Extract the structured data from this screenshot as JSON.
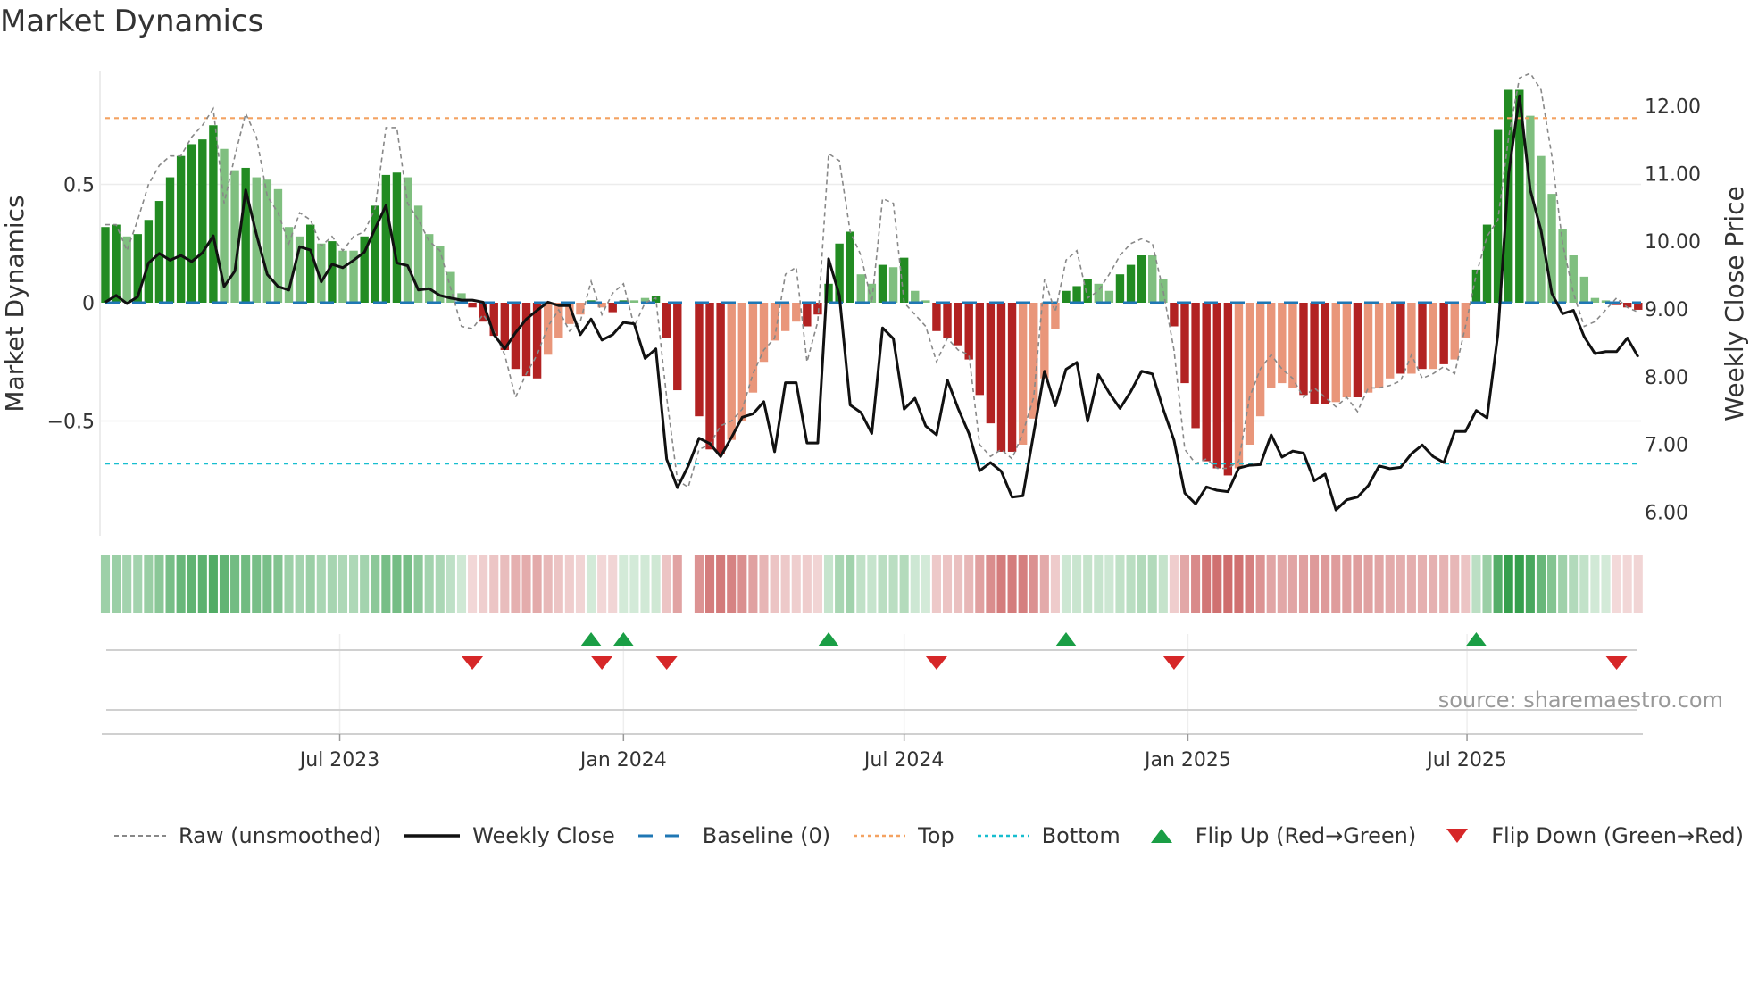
{
  "title": "Market Dynamics",
  "source": "source: sharemaestro.com",
  "legend": {
    "raw": "Raw (unsmoothed)",
    "close": "Weekly Close",
    "baseline": "Baseline (0)",
    "top": "Top",
    "bottom": "Bottom",
    "flip_up": "Flip Up (Red→Green)",
    "flip_down": "Flip Down (Green→Red)"
  },
  "colors": {
    "green_strong": "#228b22",
    "green_weak": "#7fbf7f",
    "red_strong": "#b22222",
    "red_weak": "#e9967a",
    "close": "#111111",
    "raw": "#888888",
    "baseline": "#1f77b4",
    "top": "#f4a261",
    "bottom": "#17becf",
    "flip_up": "#1a9e45",
    "flip_down": "#d62728"
  },
  "chart_data": {
    "type": "bar",
    "title": "Market Dynamics",
    "ylabel": "Market Dynamics",
    "y2label": "Weekly Close Price",
    "ylim": [
      -0.98,
      0.98
    ],
    "y2lim": [
      5.8,
      12.7
    ],
    "yticks": [
      {
        "v": 0.5,
        "label": "0.5"
      },
      {
        "v": 0,
        "label": "0"
      },
      {
        "v": -0.5,
        "label": "−0.5"
      }
    ],
    "y2ticks": [
      {
        "v": 12,
        "label": "12.00"
      },
      {
        "v": 11,
        "label": "11.00"
      },
      {
        "v": 10,
        "label": "10.00"
      },
      {
        "v": 9,
        "label": "9.00"
      },
      {
        "v": 8,
        "label": "8.00"
      },
      {
        "v": 7,
        "label": "7.00"
      },
      {
        "v": 6,
        "label": "6.00"
      }
    ],
    "xticks": [
      {
        "date": "2023-07-01",
        "label": "Jul 2023"
      },
      {
        "date": "2024-01-01",
        "label": "Jan 2024"
      },
      {
        "date": "2024-07-01",
        "label": "Jul 2024"
      },
      {
        "date": "2025-01-01",
        "label": "Jan 2025"
      },
      {
        "date": "2025-07-01",
        "label": "Jul 2025"
      }
    ],
    "start_date": "2023-01-30",
    "frequency": "weekly",
    "top_level": 0.78,
    "bottom_level": -0.68,
    "baseline": 0,
    "momentum": [
      0.32,
      0.33,
      0.28,
      0.29,
      0.35,
      0.43,
      0.53,
      0.62,
      0.67,
      0.69,
      0.75,
      0.65,
      0.56,
      0.57,
      0.53,
      0.52,
      0.48,
      0.32,
      0.28,
      0.33,
      0.25,
      0.26,
      0.22,
      0.22,
      0.28,
      0.41,
      0.54,
      0.55,
      0.53,
      0.41,
      0.29,
      0.24,
      0.13,
      0.04,
      -0.02,
      -0.08,
      -0.14,
      -0.2,
      -0.28,
      -0.31,
      -0.32,
      -0.22,
      -0.15,
      -0.09,
      -0.05,
      0.01,
      -0.02,
      -0.04,
      0.01,
      0.01,
      0.02,
      0.03,
      -0.15,
      -0.37,
      null,
      -0.48,
      -0.62,
      -0.64,
      -0.58,
      -0.5,
      -0.38,
      -0.25,
      -0.16,
      -0.12,
      -0.08,
      -0.1,
      -0.05,
      0.08,
      0.25,
      0.3,
      0.12,
      0.08,
      0.16,
      0.15,
      0.19,
      0.05,
      0.01,
      -0.12,
      -0.15,
      -0.18,
      -0.24,
      -0.39,
      -0.51,
      -0.63,
      -0.63,
      -0.6,
      -0.49,
      -0.32,
      -0.11,
      0.05,
      0.07,
      0.1,
      0.08,
      0.05,
      0.12,
      0.16,
      0.2,
      0.2,
      0.1,
      -0.1,
      -0.34,
      -0.53,
      -0.67,
      -0.7,
      -0.73,
      -0.7,
      -0.6,
      -0.48,
      -0.36,
      -0.34,
      -0.36,
      -0.39,
      -0.43,
      -0.43,
      -0.42,
      -0.4,
      -0.4,
      -0.38,
      -0.36,
      -0.32,
      -0.3,
      -0.3,
      -0.28,
      -0.28,
      -0.26,
      -0.24,
      -0.15,
      0.14,
      0.33,
      0.73,
      0.9,
      0.9,
      0.79,
      0.62,
      0.46,
      0.31,
      0.2,
      0.11,
      0.02,
      0.01,
      -0.01,
      -0.02,
      -0.03
    ],
    "strength": [
      "d",
      "d",
      "l",
      "d",
      "d",
      "d",
      "d",
      "d",
      "d",
      "d",
      "d",
      "l",
      "l",
      "d",
      "l",
      "l",
      "l",
      "l",
      "l",
      "d",
      "l",
      "d",
      "l",
      "l",
      "d",
      "d",
      "d",
      "d",
      "l",
      "l",
      "l",
      "l",
      "l",
      "l",
      "d",
      "d",
      "d",
      "d",
      "d",
      "d",
      "d",
      "l",
      "l",
      "l",
      "l",
      "d",
      "l",
      "d",
      "d",
      "l",
      "l",
      "d",
      "d",
      "d",
      "n",
      "d",
      "d",
      "d",
      "l",
      "l",
      "l",
      "l",
      "l",
      "l",
      "l",
      "d",
      "d",
      "d",
      "d",
      "d",
      "l",
      "l",
      "d",
      "l",
      "d",
      "l",
      "l",
      "d",
      "d",
      "d",
      "d",
      "d",
      "d",
      "d",
      "d",
      "l",
      "l",
      "l",
      "l",
      "d",
      "d",
      "d",
      "l",
      "l",
      "d",
      "d",
      "d",
      "l",
      "l",
      "d",
      "d",
      "d",
      "d",
      "d",
      "d",
      "l",
      "l",
      "l",
      "l",
      "l",
      "l",
      "d",
      "d",
      "d",
      "l",
      "l",
      "d",
      "l",
      "l",
      "l",
      "d",
      "l",
      "d",
      "l",
      "d",
      "l",
      "l",
      "d",
      "d",
      "d",
      "d",
      "d",
      "l",
      "l",
      "l",
      "l",
      "l",
      "l",
      "l",
      "l",
      "d",
      "d",
      "d"
    ],
    "raw": [
      0.33,
      0.33,
      0.22,
      0.35,
      0.5,
      0.58,
      0.62,
      0.62,
      0.7,
      0.75,
      0.82,
      0.42,
      0.62,
      0.8,
      0.7,
      0.45,
      0.38,
      0.25,
      0.38,
      0.35,
      0.24,
      0.28,
      0.22,
      0.28,
      0.3,
      0.4,
      0.74,
      0.74,
      0.42,
      0.35,
      0.26,
      0.22,
      0.06,
      -0.1,
      -0.11,
      -0.05,
      -0.12,
      -0.22,
      -0.4,
      -0.3,
      -0.22,
      -0.1,
      -0.03,
      -0.12,
      -0.08,
      0.09,
      -0.05,
      0.04,
      0.08,
      -0.1,
      0.0,
      0.02,
      -0.4,
      -0.75,
      -0.78,
      -0.62,
      -0.6,
      -0.52,
      -0.5,
      -0.45,
      -0.3,
      -0.2,
      -0.15,
      0.12,
      0.15,
      -0.25,
      -0.08,
      0.63,
      0.6,
      0.3,
      0.2,
      0.0,
      0.44,
      0.42,
      0.0,
      -0.05,
      -0.1,
      -0.25,
      -0.15,
      -0.2,
      -0.22,
      -0.6,
      -0.65,
      -0.62,
      -0.66,
      -0.55,
      -0.4,
      0.1,
      -0.04,
      0.18,
      0.22,
      0.02,
      0.05,
      0.12,
      0.2,
      0.25,
      0.27,
      0.25,
      0.05,
      -0.2,
      -0.62,
      -0.68,
      -0.66,
      -0.7,
      -0.7,
      -0.67,
      -0.4,
      -0.28,
      -0.22,
      -0.28,
      -0.32,
      -0.4,
      -0.36,
      -0.4,
      -0.44,
      -0.4,
      -0.46,
      -0.36,
      -0.36,
      -0.35,
      -0.33,
      -0.22,
      -0.32,
      -0.3,
      -0.27,
      -0.3,
      -0.1,
      0.12,
      0.28,
      0.35,
      0.7,
      0.95,
      0.97,
      0.9,
      0.62,
      0.25,
      0.04,
      -0.1,
      -0.08,
      -0.03,
      0.02,
      -0.02,
      -0.04
    ],
    "close": [
      9.1,
      9.2,
      9.08,
      9.18,
      9.68,
      9.82,
      9.72,
      9.79,
      9.7,
      9.83,
      10.08,
      9.33,
      9.56,
      10.76,
      10.1,
      9.51,
      9.33,
      9.28,
      9.92,
      9.87,
      9.4,
      9.66,
      9.61,
      9.72,
      9.84,
      10.19,
      10.53,
      9.68,
      9.64,
      9.28,
      9.3,
      9.2,
      9.16,
      9.13,
      9.13,
      9.1,
      8.62,
      8.41,
      8.65,
      8.85,
      8.98,
      9.1,
      9.05,
      9.05,
      8.62,
      8.85,
      8.54,
      8.62,
      8.8,
      8.78,
      8.27,
      8.41,
      6.78,
      6.36,
      6.68,
      7.09,
      7.01,
      6.82,
      7.1,
      7.4,
      7.45,
      7.63,
      6.89,
      7.91,
      7.91,
      7.02,
      7.02,
      9.74,
      9.2,
      7.58,
      7.47,
      7.16,
      8.72,
      8.56,
      7.52,
      7.68,
      7.27,
      7.14,
      7.95,
      7.53,
      7.16,
      6.61,
      6.73,
      6.6,
      6.22,
      6.24,
      7.16,
      8.08,
      7.57,
      8.11,
      8.21,
      7.34,
      8.03,
      7.76,
      7.53,
      7.78,
      8.08,
      8.04,
      7.52,
      7.06,
      6.28,
      6.12,
      6.37,
      6.32,
      6.3,
      6.65,
      6.69,
      6.7,
      7.14,
      6.81,
      6.9,
      6.87,
      6.46,
      6.56,
      6.03,
      6.18,
      6.22,
      6.39,
      6.68,
      6.64,
      6.66,
      6.86,
      6.99,
      6.82,
      6.73,
      7.19,
      7.19,
      7.5,
      7.39,
      8.62,
      11.0,
      12.15,
      10.76,
      10.16,
      9.23,
      8.93,
      8.98,
      8.59,
      8.34,
      8.37,
      8.37,
      8.57,
      8.29
    ],
    "flip_up_weeks": [
      45,
      48,
      67,
      89,
      127
    ],
    "flip_down_weeks": [
      34,
      46,
      52,
      77,
      99,
      140
    ],
    "grid": true,
    "legend_position": "bottom"
  }
}
